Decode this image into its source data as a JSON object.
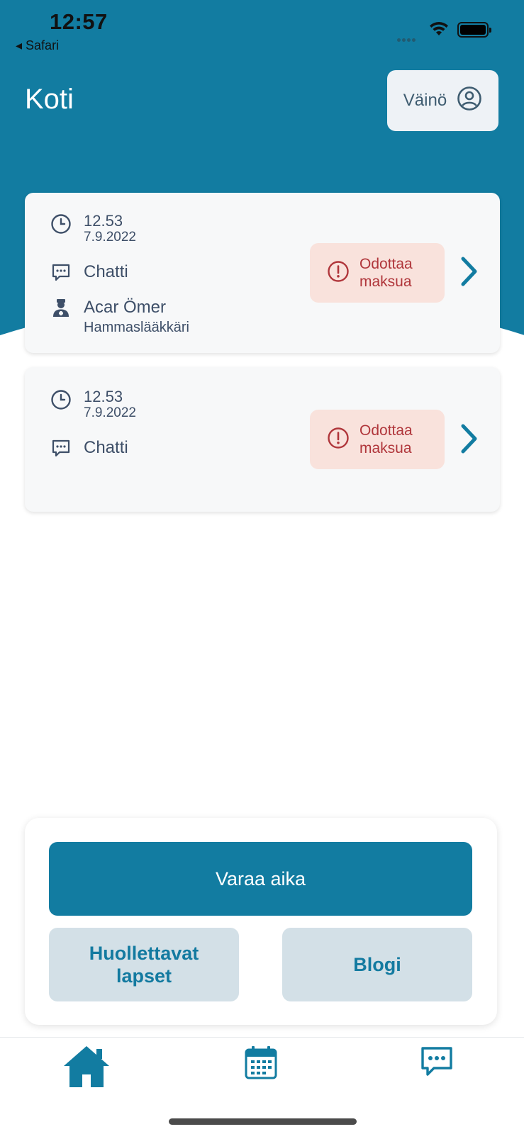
{
  "status_bar": {
    "time": "12:57",
    "back_app": "◂ Safari"
  },
  "header": {
    "title": "Koti",
    "profile_name": "Väinö"
  },
  "appointments": [
    {
      "time": "12.53",
      "date": "7.9.2022",
      "type": "Chatti",
      "provider_name": "Acar Ömer",
      "provider_role": "Hammaslääkkäri",
      "status_line1": "Odottaa",
      "status_line2": "maksua"
    },
    {
      "time": "12.53",
      "date": "7.9.2022",
      "type": "Chatti",
      "status_line1": "Odottaa",
      "status_line2": "maksua"
    }
  ],
  "actions": {
    "book": "Varaa aika",
    "children_line1": "Huollettavat",
    "children_line2": "lapset",
    "blog": "Blogi"
  },
  "tabbar": {
    "items": [
      "home-icon",
      "calendar-icon",
      "chat-icon"
    ],
    "active": "home"
  },
  "colors": {
    "primary": "#127ca1",
    "badge_bg": "#f9e2dc",
    "badge_text": "#b0363b",
    "secondary_bg": "#d3e0e7"
  }
}
